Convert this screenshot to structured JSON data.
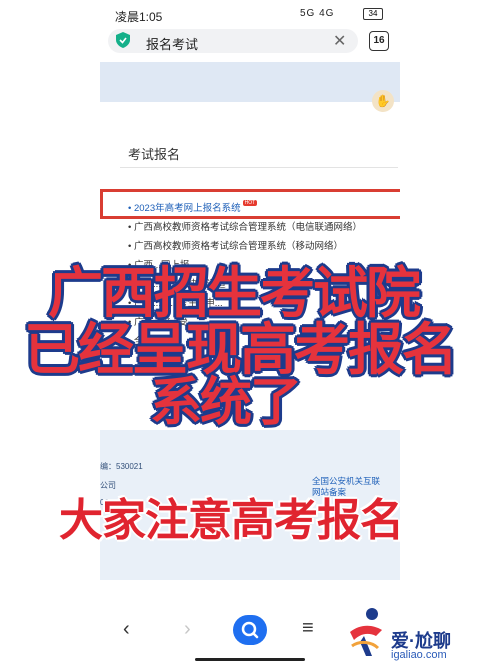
{
  "status_bar": {
    "time": "凌晨1:05",
    "signal_text": "5G  4G",
    "battery": "34"
  },
  "browser": {
    "search_text": "报名考试",
    "tab_count": "16"
  },
  "page": {
    "section_title": "考试报名",
    "links": [
      {
        "text": "2023年高考网上报名系统",
        "badge": "HOT"
      },
      {
        "text": "广西高校教师资格考试综合管理系统（电信联通网络）"
      },
      {
        "text": "广西高校教师资格考试综合管理系统（移动网络）"
      },
      {
        "text": "广西...网上报..."
      },
      {
        "text": "广西...学业...快速通道"
      },
      {
        "text": "广西...考...考生...申..."
      },
      {
        "text": "广西...校...受..."
      },
      {
        "text": "全国...务..."
      }
    ],
    "footer": {
      "postcode": "编：530021",
      "fragment_1": "公司",
      "fragment_2": "09",
      "police": [
        "全国公安机关互联",
        "网站备案"
      ]
    }
  },
  "overlay": {
    "line1": "广西招生考试院",
    "line2": "已经呈现高考报名",
    "line3": "系统了",
    "line4": "大家注意高考报名"
  },
  "watermark": {
    "brand": "爱·尬聊",
    "url": "igaliao.com"
  },
  "colors": {
    "overlay_red": "#e5333d",
    "outline_blue": "#1d3b8c",
    "accent_blue": "#1f6ff0"
  }
}
